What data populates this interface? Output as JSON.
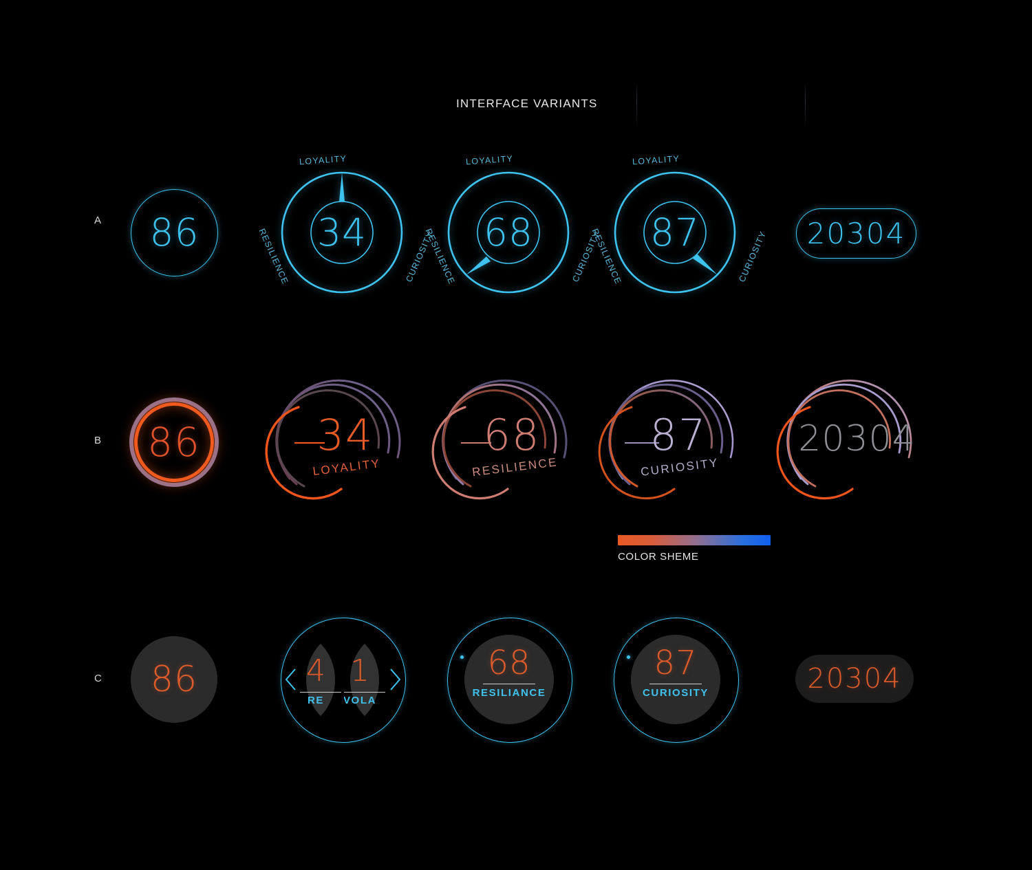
{
  "page": {
    "title": "INTERFACE VARIANTS",
    "background": "#000000"
  },
  "colors": {
    "cyan": "#3ec3f0",
    "orange": "#e85a26",
    "purple": "#9b8ec4",
    "salmon": "#cf7d73",
    "grey_text": "#9a9a9a",
    "disc_fill": "#2b2b2b"
  },
  "rows": [
    {
      "id": "A",
      "label": "A"
    },
    {
      "id": "B",
      "label": "B"
    },
    {
      "id": "C",
      "label": "C"
    }
  ],
  "row_a": {
    "badge": {
      "value": "86"
    },
    "gauges": [
      {
        "value": "34",
        "labels": {
          "top": "LOYALITY",
          "left": "RESILIENCE",
          "right": "CURIOSITY"
        },
        "pointer": "top"
      },
      {
        "value": "68",
        "labels": {
          "top": "LOYALITY",
          "left": "RESILIENCE",
          "right": "CURIOSITY"
        },
        "pointer": "lower-left"
      },
      {
        "value": "87",
        "labels": {
          "top": "LOYALITY",
          "left": "RESILIENCE",
          "right": "CURIOSITY"
        },
        "pointer": "lower-right"
      }
    ],
    "pill": {
      "value": "20304"
    }
  },
  "row_b": {
    "badge": {
      "value": "86"
    },
    "gauges": [
      {
        "value": "34",
        "label": "LOYALITY",
        "accent": "#e85a26"
      },
      {
        "value": "68",
        "label": "RESILIENCE",
        "accent": "#cf7d73"
      },
      {
        "value": "87",
        "label": "CURIOSITY",
        "accent": "#b3a6d6"
      }
    ],
    "pill": {
      "value": "20304"
    }
  },
  "color_scheme": {
    "label": "COLOR SHEME",
    "from": "#e85a26",
    "to": "#1060f0"
  },
  "row_c": {
    "badge": {
      "value": "86"
    },
    "selector": {
      "left_arrow": "chevron-left-icon",
      "right_arrow": "chevron-right-icon",
      "items": [
        {
          "value": "4",
          "label": "RE"
        },
        {
          "value": "1",
          "label": "VOLA"
        }
      ]
    },
    "gauges": [
      {
        "value": "68",
        "label": "RESILIANCE"
      },
      {
        "value": "87",
        "label": "CURIOSITY"
      }
    ],
    "pill": {
      "value": "20304"
    }
  }
}
